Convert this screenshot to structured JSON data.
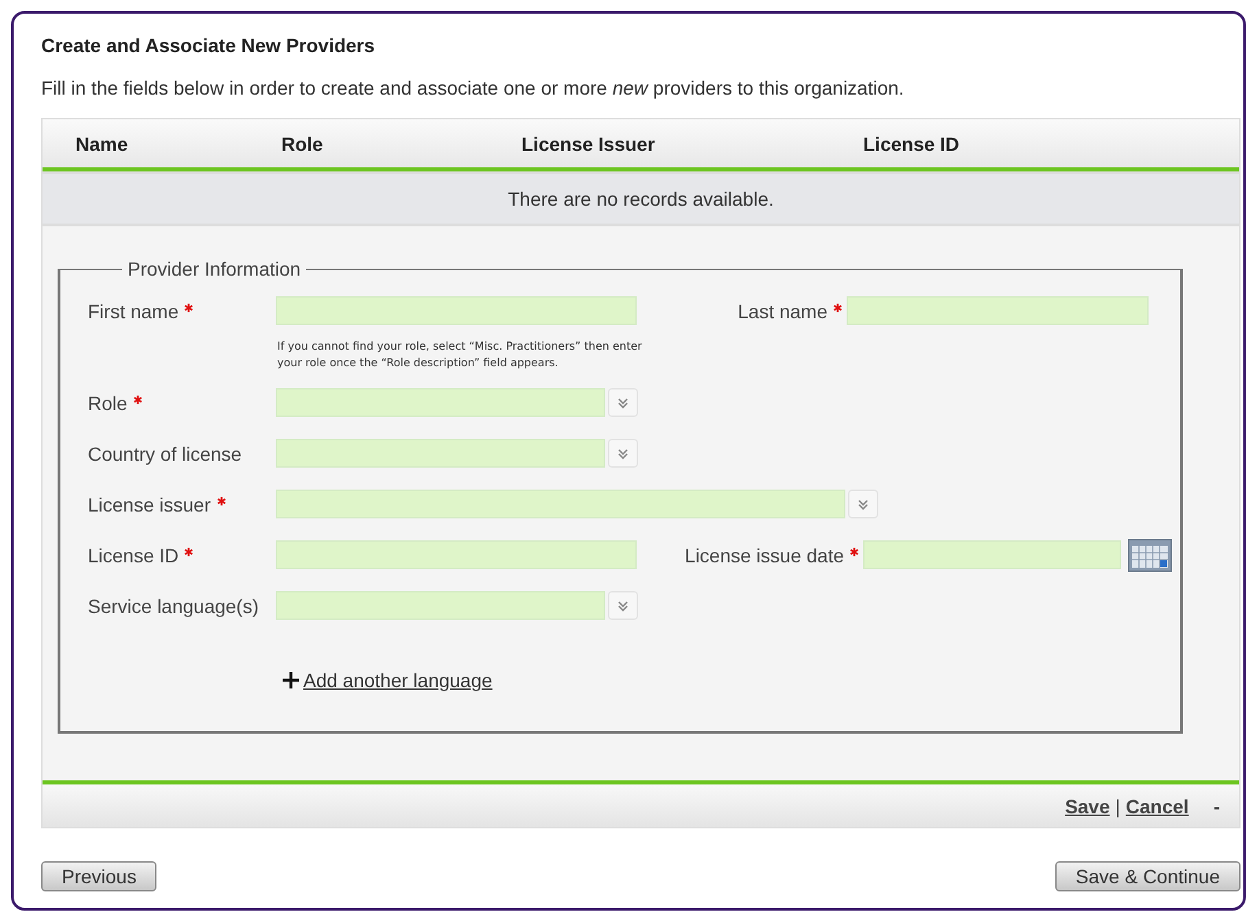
{
  "title": "Create and Associate New Providers",
  "intro": "Fill in the fields below in order to create and associate one or more *new* providers to this organization.",
  "table": {
    "columns": [
      "Name",
      "Role",
      "License Issuer",
      "License ID"
    ],
    "empty_message": "There are no records available."
  },
  "fieldset": {
    "legend": "Provider Information",
    "rows": [
      {
        "fields": [
          {
            "label": "First name",
            "required": true,
            "kind": "text"
          },
          {
            "label": "Last name",
            "required": true,
            "kind": "text"
          }
        ]
      },
      {
        "hint": "If you cannot find your role, select “Misc. Practitioners” then enter your role once the “Role description” field appears."
      },
      {
        "fields": [
          {
            "label": "Role",
            "required": true,
            "kind": "select"
          }
        ]
      },
      {
        "fields": [
          {
            "label": "Country of license",
            "required": false,
            "kind": "select"
          }
        ]
      },
      {
        "fields": [
          {
            "label": "License issuer",
            "required": true,
            "kind": "select_wide"
          }
        ]
      },
      {
        "fields": [
          {
            "label": "License ID",
            "required": true,
            "kind": "text"
          },
          {
            "label": "License issue date",
            "required": true,
            "kind": "date"
          }
        ]
      },
      {
        "fields": [
          {
            "label": "Service language(s)",
            "required": false,
            "kind": "select"
          }
        ]
      }
    ],
    "add_link": "Add another language"
  },
  "footer": {
    "links": [
      "Save",
      "Cancel"
    ],
    "separator": "|",
    "collapse": "-"
  },
  "buttons": {
    "previous": "Previous",
    "next": "Save & Continue"
  }
}
